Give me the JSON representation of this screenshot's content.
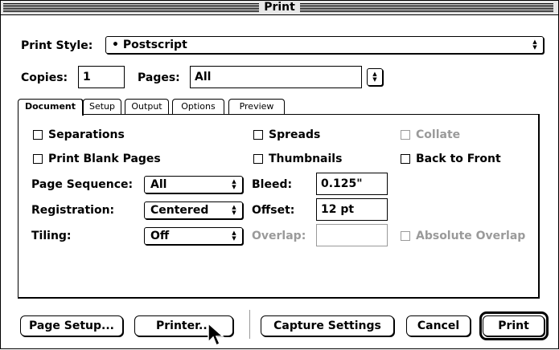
{
  "window": {
    "title": "Print"
  },
  "print_style": {
    "label": "Print Style:",
    "value": "• Postscript"
  },
  "copies": {
    "label": "Copies:",
    "value": "1"
  },
  "pages": {
    "label": "Pages:",
    "value": "All"
  },
  "tabs": [
    {
      "label": "Document",
      "active": true
    },
    {
      "label": "Setup",
      "active": false
    },
    {
      "label": "Output",
      "active": false
    },
    {
      "label": "Options",
      "active": false
    },
    {
      "label": "Preview",
      "active": false
    }
  ],
  "document": {
    "separations": {
      "label": "Separations",
      "checked": false,
      "enabled": true
    },
    "spreads": {
      "label": "Spreads",
      "checked": false,
      "enabled": true
    },
    "collate": {
      "label": "Collate",
      "checked": false,
      "enabled": false
    },
    "print_blank_pages": {
      "label": "Print Blank Pages",
      "checked": false,
      "enabled": true
    },
    "thumbnails": {
      "label": "Thumbnails",
      "checked": false,
      "enabled": true
    },
    "back_to_front": {
      "label": "Back to Front",
      "checked": false,
      "enabled": true
    },
    "page_sequence": {
      "label": "Page Sequence:",
      "value": "All"
    },
    "registration": {
      "label": "Registration:",
      "value": "Centered"
    },
    "tiling": {
      "label": "Tiling:",
      "value": "Off"
    },
    "bleed": {
      "label": "Bleed:",
      "value": "0.125\""
    },
    "offset": {
      "label": "Offset:",
      "value": "12 pt"
    },
    "overlap": {
      "label": "Overlap:",
      "value": "",
      "enabled": false
    },
    "absolute_overlap": {
      "label": "Absolute Overlap",
      "checked": false,
      "enabled": false
    }
  },
  "buttons": {
    "page_setup": "Page Setup...",
    "printer": "Printer...",
    "capture_settings": "Capture Settings",
    "cancel": "Cancel",
    "print": "Print"
  },
  "icons": {
    "popup_arrows": "updown-arrows-icon",
    "cursor": "arrow-cursor-icon"
  },
  "colors": {
    "disabled": "#9a9a9a",
    "title_bar": "#e8e8e8"
  }
}
